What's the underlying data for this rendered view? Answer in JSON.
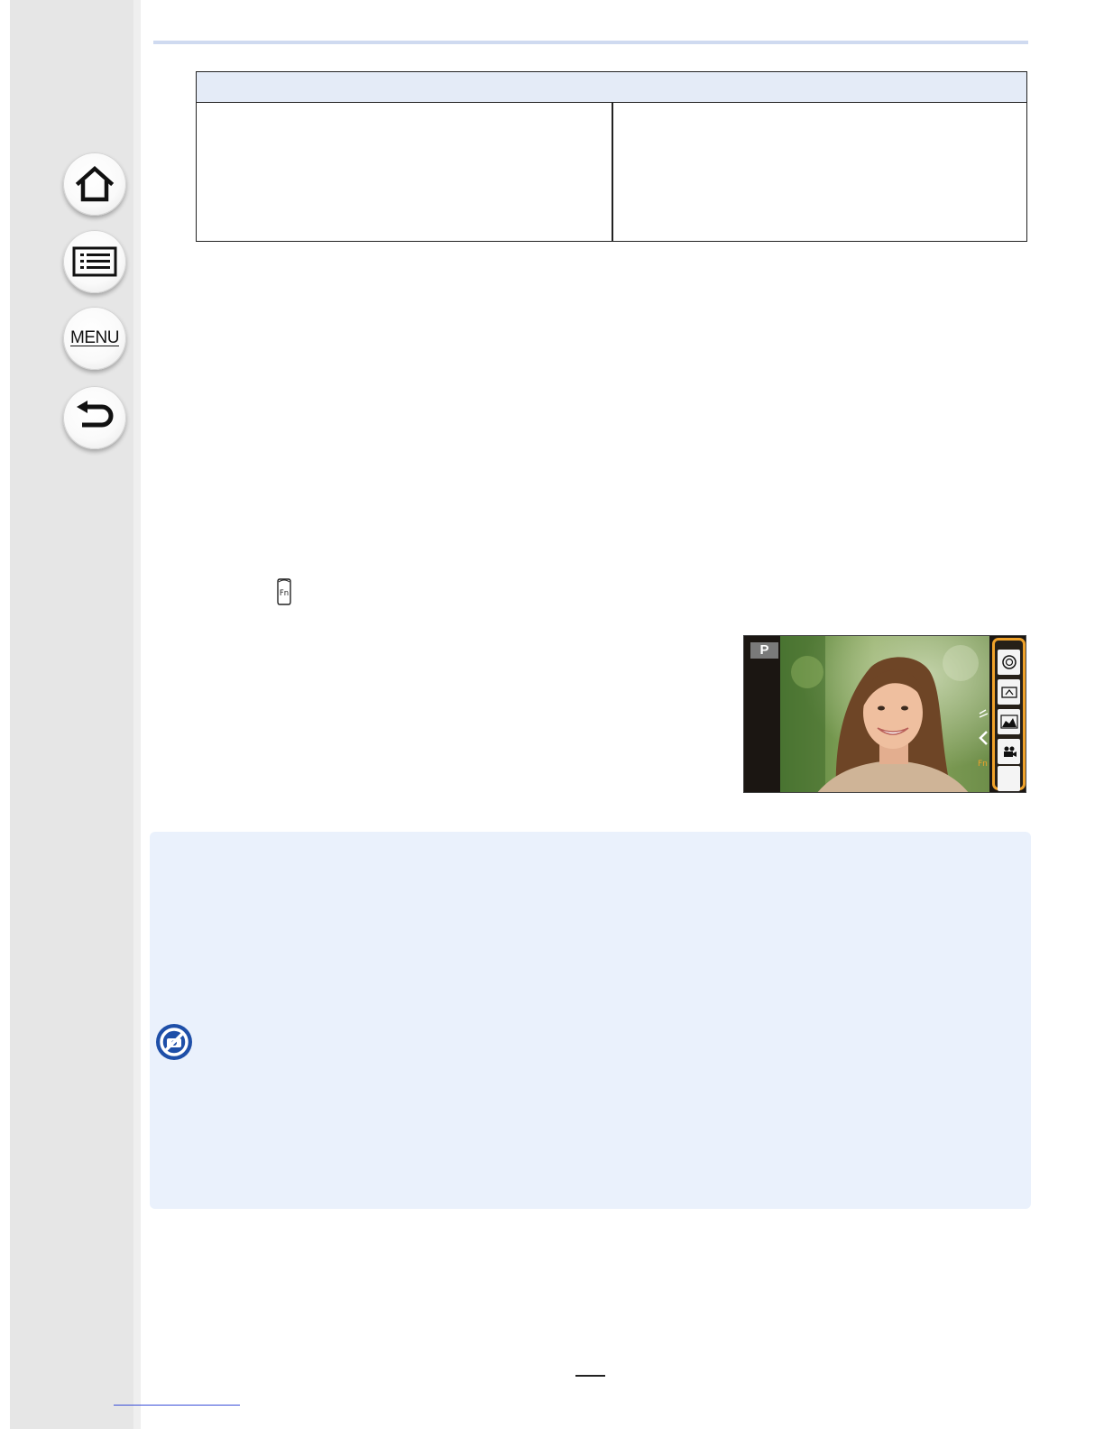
{
  "sidebar": {
    "buttons": [
      {
        "icon": "home-icon"
      },
      {
        "icon": "contents-list-icon"
      },
      {
        "icon": "menu-icon",
        "label": "MENU"
      },
      {
        "icon": "back-arrow-icon"
      }
    ]
  },
  "inline_icons": {
    "fn_button": "Fn"
  },
  "camera_screen": {
    "mode": "P",
    "panel_icons": [
      "aperture-icon",
      "wifi-image-icon",
      "histogram-icon",
      "movie-icon",
      "blank-slot"
    ],
    "accent_color": "#f0a22a"
  },
  "colors": {
    "table_header": "#e4ebf7",
    "note_background": "#eaf1fc",
    "note_icon": "#1e4fa8"
  }
}
